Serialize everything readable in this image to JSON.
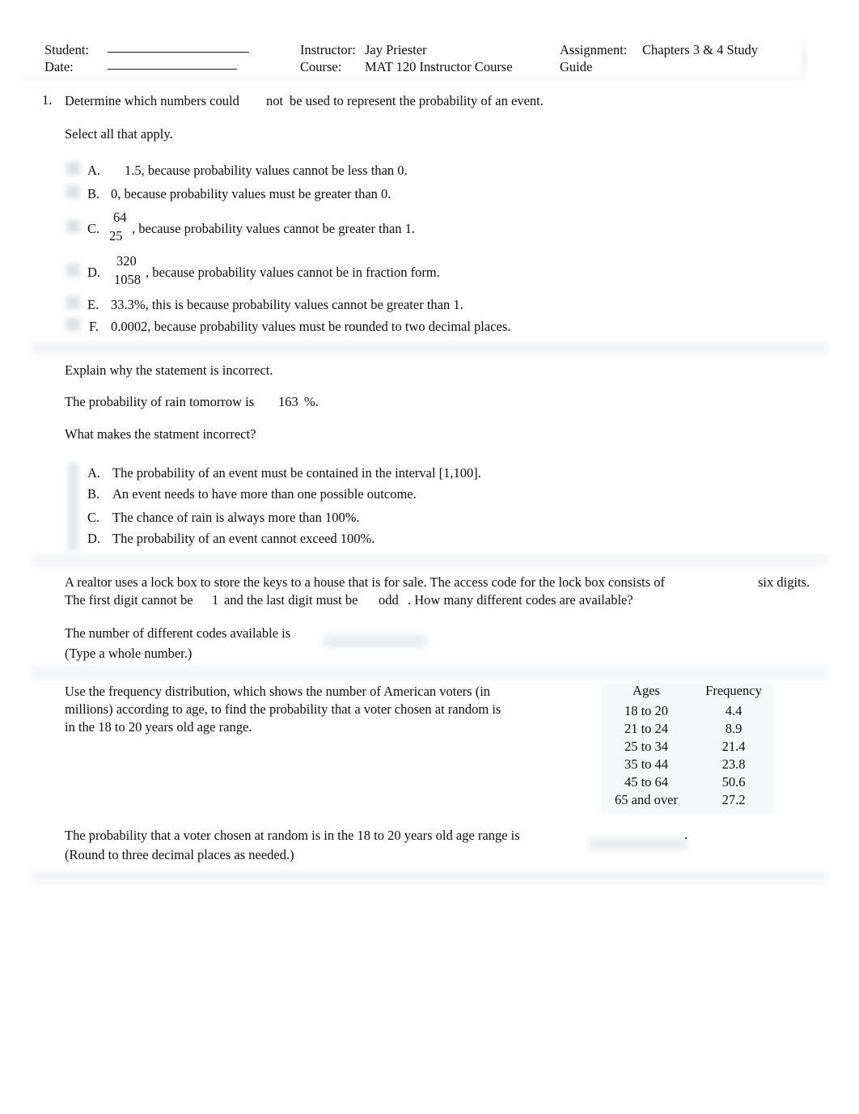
{
  "header": {
    "student_label": "Student:",
    "student_value": "",
    "date_label": "Date:",
    "date_value": "",
    "instructor_label": "Instructor:",
    "instructor_value": "Jay Priester",
    "course_label": "Course:",
    "course_value": "MAT 120 Instructor Course",
    "assignment_label": "Assignment:",
    "assignment_value": "Chapters 3 & 4 Study",
    "assignment_value_line2": "Guide"
  },
  "questions": [
    {
      "number": "1.",
      "prompt_a": "Determine which numbers could",
      "prompt_emph": "not",
      "prompt_b": "be used to represent the probability of an event.",
      "instruction": "Select all that apply.",
      "options": [
        {
          "letter": "A.",
          "text": "1.5, because probability values cannot be less than 0."
        },
        {
          "letter": "B.",
          "text": "0, because probability values must be greater than 0."
        },
        {
          "letter": "C.",
          "numerator": "64",
          "denominator": "25",
          "text": ", because probability values cannot be greater than 1."
        },
        {
          "letter": "D.",
          "numerator": "320",
          "denominator": "1058",
          "text": ", because probability values cannot be in fraction form."
        },
        {
          "letter": "E.",
          "text": "33.3%, this is because probability values cannot be greater than 1."
        },
        {
          "letter": "F.",
          "text": "0.0002, because probability values must be rounded to two decimal places."
        }
      ]
    },
    {
      "prompt": "Explain why the statement is incorrect.",
      "statement_a": "The probability of rain tomorrow is",
      "statement_value": "163",
      "statement_b": "%.",
      "sub_prompt": "What makes the statment incorrect?",
      "options": [
        {
          "letter": "A.",
          "text": "The probability of an event must be contained in the interval [1,100]."
        },
        {
          "letter": "B.",
          "text": "An event needs to have more than one possible outcome."
        },
        {
          "letter": "C.",
          "text": "The chance of rain is always more than 100%."
        },
        {
          "letter": "D.",
          "text": "The probability of an event cannot exceed 100%."
        }
      ]
    },
    {
      "line1_a": "A realtor uses a lock box to store the keys to a house that is for sale. The access code for the lock box consists of",
      "line1_digits": "six digits.",
      "line2_a": "The first digit cannot be",
      "line2_first": "1",
      "line2_b": "and the last digit must be",
      "line2_last": "odd",
      "line2_c": ". How many different codes are available?",
      "answer_prompt": "The number of different codes available is",
      "answer_value": "",
      "answer_hint": "(Type a whole number.)"
    },
    {
      "line1": "Use the frequency distribution, which shows the number of American voters (in",
      "line2": "millions) according to age, to find the probability that a voter chosen at random is",
      "line3": "in the 18 to 20 years old age range.",
      "table": {
        "columns": [
          "Ages",
          "Frequency"
        ],
        "rows": [
          [
            "18 to 20",
            "4.4"
          ],
          [
            "21 to 24",
            "8.9"
          ],
          [
            "25 to 34",
            "21.4"
          ],
          [
            "35 to 44",
            "23.8"
          ],
          [
            "45 to 64",
            "50.6"
          ],
          [
            "65 and over",
            "27.2"
          ]
        ]
      },
      "answer_prompt": "The probability that a voter chosen at random is in the 18 to 20 years old age range is",
      "answer_value": "",
      "answer_period": ".",
      "answer_hint": "(Round to three decimal places as needed.)"
    }
  ]
}
